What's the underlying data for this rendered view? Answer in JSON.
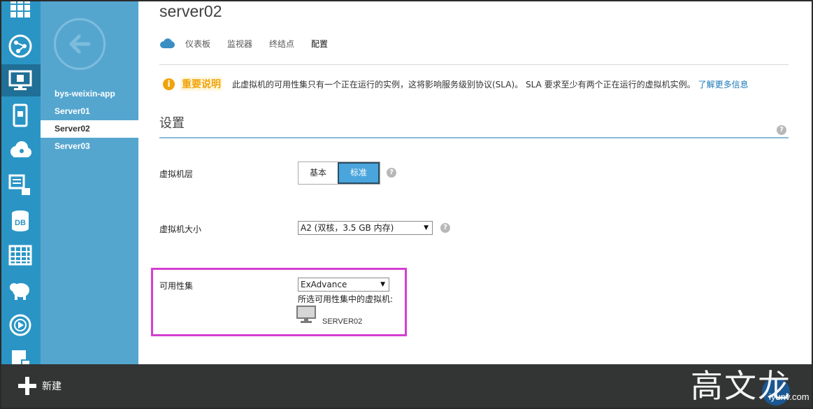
{
  "page": {
    "title": "server02"
  },
  "tabs": [
    {
      "label": "仪表板"
    },
    {
      "label": "监视器"
    },
    {
      "label": "终结点"
    },
    {
      "label": "配置"
    }
  ],
  "rail": {
    "icons": [
      "all-items-icon",
      "web-sites-icon",
      "virtual-machines-icon",
      "mobile-services-icon",
      "cloud-services-icon",
      "batch-icon",
      "sql-databases-icon",
      "storage-icon",
      "hdinsight-icon",
      "media-services-icon",
      "service-bus-icon"
    ]
  },
  "subnav": {
    "items": [
      {
        "label": "bys-weixin-app"
      },
      {
        "label": "Server01"
      },
      {
        "label": "Server02"
      },
      {
        "label": "Server03"
      }
    ]
  },
  "notice": {
    "badge": "i",
    "important": "重要说明",
    "text": "此虚拟机的可用性集只有一个正在运行的实例，这将影响服务级别协议(SLA)。 SLA 要求至少有两个正在运行的虚拟机实例。",
    "link": "了解更多信息",
    "accent_color": "#f0a30a"
  },
  "settings": {
    "title": "设置",
    "tier": {
      "label": "虚拟机层",
      "options": [
        "基本",
        "标准"
      ],
      "selected": "标准"
    },
    "size": {
      "label": "虚拟机大小",
      "value": "A2 (双核，3.5 GB 内存)"
    },
    "availability": {
      "label": "可用性集",
      "value": "ExAdvance",
      "vm_caption": "所选可用性集中的虚拟机:",
      "vms": [
        "SERVER02"
      ]
    },
    "help_glyph": "?"
  },
  "bottombar": {
    "new_label": "新建"
  },
  "watermark": {
    "text": "高文龙",
    "site": "iyunv.com"
  },
  "colors": {
    "rail": "#2a95c5",
    "subnav": "#55a6cf",
    "selected_button": "#4aa5dd",
    "highlight_border": "#d33fd1",
    "bottombar": "#333434",
    "link": "#1b7ab8"
  }
}
